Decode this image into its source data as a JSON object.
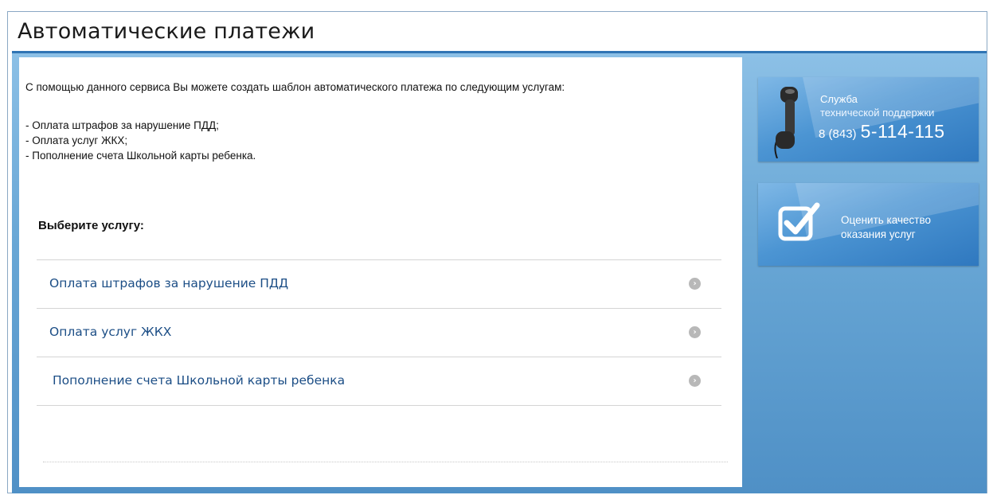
{
  "page": {
    "title": "Автоматические платежи"
  },
  "main": {
    "intro": "С помощью данного сервиса Вы можете создать шаблон автоматического платежа по следующим услугам:",
    "bullets": [
      "- Оплата штрафов за нарушение ПДД;",
      "- Оплата услуг ЖКХ;",
      "- Пополнение счета Школьной карты ребенка."
    ],
    "choose_label": "Выберите услугу:",
    "services": [
      {
        "label": "Оплата штрафов за нарушение ПДД",
        "icon": "arrow-right-icon"
      },
      {
        "label": "Оплата услуг ЖКХ",
        "icon": "arrow-right-icon"
      },
      {
        "label": "Пополнение счета Школьной карты ребенка",
        "icon": "arrow-right-icon"
      }
    ]
  },
  "sidebar": {
    "support": {
      "icon": "phone-handset-icon",
      "title": "Служба",
      "subtitle": "технической поддержки",
      "phone_code": "8 (843)",
      "phone_number": "5-114-115"
    },
    "quality": {
      "icon": "checkbox-check-icon",
      "text": "Оценить качество оказания услуг"
    }
  },
  "colors": {
    "link": "#1c4e86",
    "panel_blue": "#4f90c6",
    "banner_blue": "#3f89cb",
    "separator": "#d4d4d4"
  }
}
